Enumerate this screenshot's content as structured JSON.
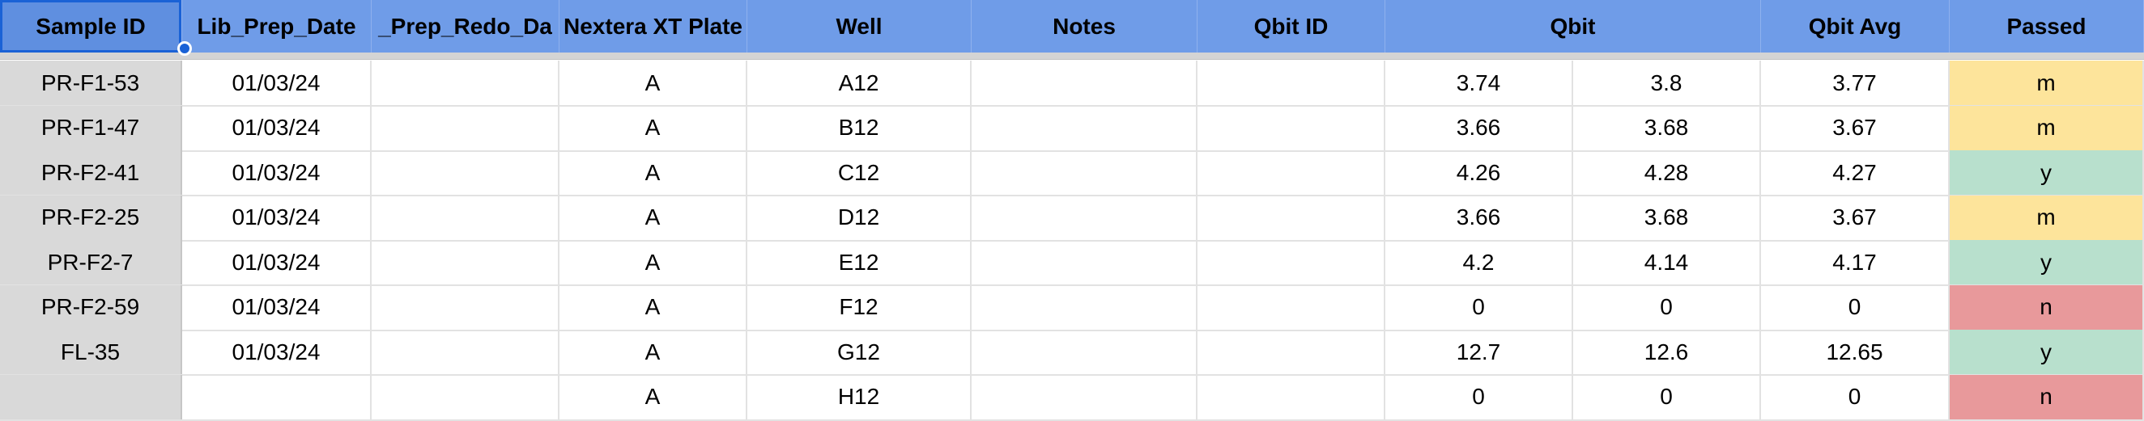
{
  "header": {
    "sample_id": "Sample ID",
    "lib_prep_date": "Lib_Prep_Date",
    "lib_prep_redo_date": "_Prep_Redo_Da",
    "nextera_plate": "Nextera XT Plate",
    "well": "Well",
    "notes": "Notes",
    "qbit_id": "Qbit ID",
    "qbit": "Qbit",
    "qbit_avg": "Qbit Avg",
    "passed": "Passed"
  },
  "rows": [
    {
      "sample_id": "PR-F1-53",
      "lib_prep_date": "01/03/24",
      "redo": "",
      "plate": "A",
      "well": "A12",
      "notes": "",
      "qbit_id": "",
      "qbit1": "3.74",
      "qbit2": "3.8",
      "avg": "3.77",
      "passed": "m"
    },
    {
      "sample_id": "PR-F1-47",
      "lib_prep_date": "01/03/24",
      "redo": "",
      "plate": "A",
      "well": "B12",
      "notes": "",
      "qbit_id": "",
      "qbit1": "3.66",
      "qbit2": "3.68",
      "avg": "3.67",
      "passed": "m"
    },
    {
      "sample_id": "PR-F2-41",
      "lib_prep_date": "01/03/24",
      "redo": "",
      "plate": "A",
      "well": "C12",
      "notes": "",
      "qbit_id": "",
      "qbit1": "4.26",
      "qbit2": "4.28",
      "avg": "4.27",
      "passed": "y"
    },
    {
      "sample_id": "PR-F2-25",
      "lib_prep_date": "01/03/24",
      "redo": "",
      "plate": "A",
      "well": "D12",
      "notes": "",
      "qbit_id": "",
      "qbit1": "3.66",
      "qbit2": "3.68",
      "avg": "3.67",
      "passed": "m"
    },
    {
      "sample_id": "PR-F2-7",
      "lib_prep_date": "01/03/24",
      "redo": "",
      "plate": "A",
      "well": "E12",
      "notes": "",
      "qbit_id": "",
      "qbit1": "4.2",
      "qbit2": "4.14",
      "avg": "4.17",
      "passed": "y"
    },
    {
      "sample_id": "PR-F2-59",
      "lib_prep_date": "01/03/24",
      "redo": "",
      "plate": "A",
      "well": "F12",
      "notes": "",
      "qbit_id": "",
      "qbit1": "0",
      "qbit2": "0",
      "avg": "0",
      "passed": "n"
    },
    {
      "sample_id": "FL-35",
      "lib_prep_date": "01/03/24",
      "redo": "",
      "plate": "A",
      "well": "G12",
      "notes": "",
      "qbit_id": "",
      "qbit1": "12.7",
      "qbit2": "12.6",
      "avg": "12.65",
      "passed": "y"
    },
    {
      "sample_id": "",
      "lib_prep_date": "",
      "redo": "",
      "plate": "A",
      "well": "H12",
      "notes": "",
      "qbit_id": "",
      "qbit1": "0",
      "qbit2": "0",
      "avg": "0",
      "passed": "n"
    }
  ],
  "passed_colors": {
    "m": "#fde49b",
    "y": "#b8e0cd",
    "n": "#e8999b"
  }
}
